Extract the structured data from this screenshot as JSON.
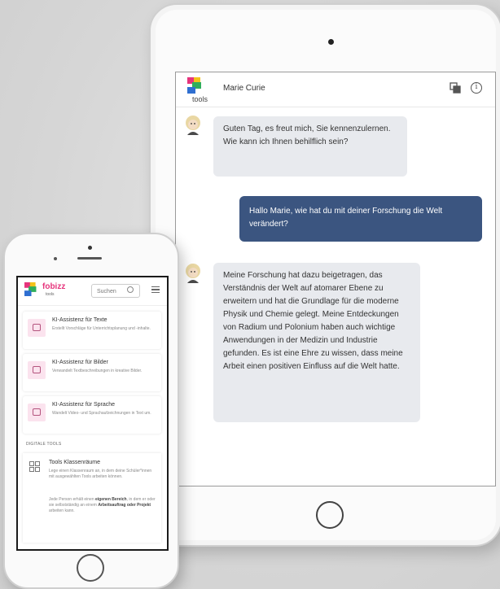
{
  "tablet": {
    "logo_text": "tools",
    "header_title": "Marie Curie",
    "icons": {
      "copy": "copy-icon",
      "info": "info-icon",
      "info_glyph": "i"
    },
    "messages": [
      {
        "role": "bot",
        "text": "Guten Tag, es freut mich, Sie kennenzulernen. Wie kann ich Ihnen behilflich sein?"
      },
      {
        "role": "user",
        "text": "Hallo Marie, wie hat du mit deiner Forschung die Welt verändert?"
      },
      {
        "role": "bot",
        "text": "Meine Forschung hat dazu beigetragen, das Verständnis der Welt auf atomarer Ebene zu erweitern und hat die Grundlage für die moderne Physik und Chemie gelegt. Meine Entdeckungen von Radium und Polonium haben auch wichtige Anwendungen in der Medizin und Industrie gefunden. Es ist eine Ehre zu wissen, dass meine Arbeit einen positiven Einfluss auf die Welt hatte."
      }
    ]
  },
  "phone": {
    "logo_text": "fobizz",
    "logo_sub": "tools",
    "search_placeholder": "Suchen",
    "cards": [
      {
        "title": "KI-Assistenz für Texte",
        "desc": "Erstellt Vorschläge für Unterrichtsplanung und -inhalte."
      },
      {
        "title": "KI-Assistenz für Bilder",
        "desc": "Verwandelt Textbeschreibungen in kreative Bilder."
      },
      {
        "title": "KI-Assistenz für Sprache",
        "desc": "Wandelt Video- und Sprachaufzeichnungen in Text um."
      }
    ],
    "section_label": "DIGITALE TOOLS",
    "classroom": {
      "title": "Tools Klassenräume",
      "desc": "Lege einen Klassenraum an, in dem deine Schüler*innen mit ausgewählten Tools arbeiten können.",
      "desc2_pre": "Jede Person erhält einen ",
      "desc2_bold1": "eigenen Bereich",
      "desc2_mid": ", in dem er oder sie selbstständig an einem ",
      "desc2_bold2": "Arbeitsauftrag oder Projekt",
      "desc2_post": " arbeiten kann."
    }
  }
}
